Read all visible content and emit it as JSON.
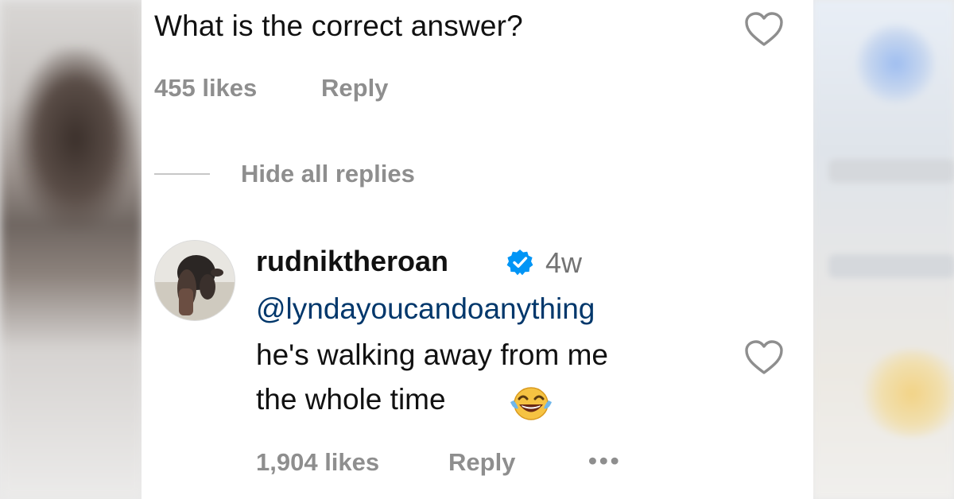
{
  "parent_comment": {
    "text": "What is the correct answer?",
    "likes": "455 likes",
    "reply_label": "Reply"
  },
  "thread": {
    "hide_replies_label": "Hide all replies"
  },
  "reply": {
    "username": "rudniktheroan",
    "time": "4w",
    "mention": "@lyndayoucandoanything",
    "text_line1": "he's walking away from me",
    "text_line2": "the whole time",
    "likes": "1,904 likes",
    "reply_label": "Reply",
    "more_label": "•••"
  },
  "icons": {
    "heart": "heart-outline-icon",
    "verified": "verified-badge-icon",
    "emoji": "tears-of-joy-emoji"
  },
  "colors": {
    "text": "#111111",
    "meta": "#8e8e8e",
    "mention": "#00376b",
    "verified": "#0095f6"
  }
}
